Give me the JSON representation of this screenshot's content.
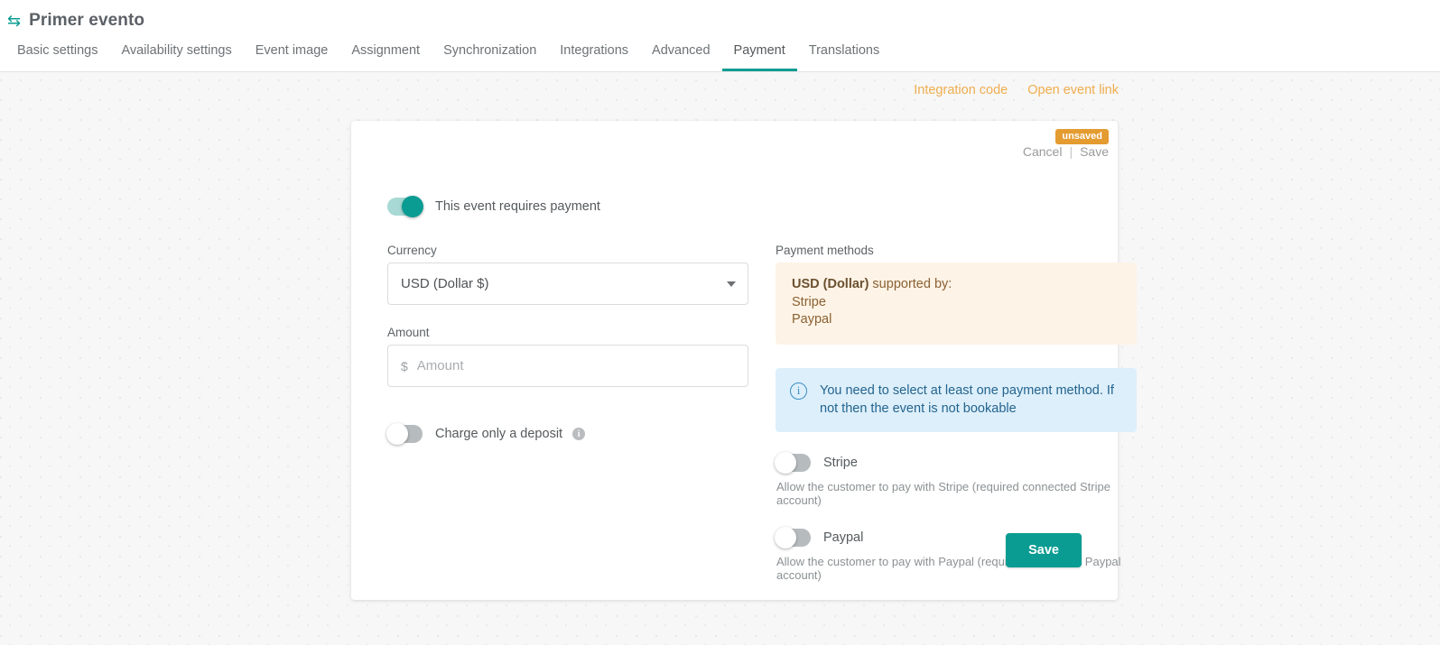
{
  "header": {
    "icon": "exchange-icon",
    "title": "Primer evento",
    "tabs": [
      {
        "label": "Basic settings",
        "active": false
      },
      {
        "label": "Availability settings",
        "active": false
      },
      {
        "label": "Event image",
        "active": false
      },
      {
        "label": "Assignment",
        "active": false
      },
      {
        "label": "Synchronization",
        "active": false
      },
      {
        "label": "Integrations",
        "active": false
      },
      {
        "label": "Advanced",
        "active": false
      },
      {
        "label": "Payment",
        "active": true
      },
      {
        "label": "Translations",
        "active": false
      }
    ]
  },
  "top_links": {
    "integration_code": "Integration code",
    "open_event_link": "Open event link",
    "color": "#f0ad4e"
  },
  "card": {
    "badge": "unsaved",
    "badge_color": "#e49b30",
    "cancel": "Cancel",
    "separator": "|",
    "save_small": "Save",
    "requires_payment": {
      "label": "This event requires payment",
      "state": "on"
    },
    "currency": {
      "label": "Currency",
      "value": "USD (Dollar $)",
      "options": [
        "USD (Dollar $)"
      ]
    },
    "amount": {
      "label": "Amount",
      "prefix": "$",
      "value": "",
      "placeholder": "Amount"
    },
    "deposit": {
      "label": "Charge only a deposit",
      "state": "off",
      "info_icon": "info-icon"
    },
    "payment_methods": {
      "label": "Payment methods",
      "supported_prefix": "USD (Dollar)",
      "supported_suffix": " supported by:",
      "supported_list": [
        "Stripe",
        "Paypal"
      ],
      "warning_bg": "#fdf3e6",
      "warning_text_color": "#8a6132",
      "info_notice": "You need to select at least one payment method. If not then the event is not bookable",
      "info_bg": "#ddeffa",
      "info_text_color": "#23648f",
      "methods": [
        {
          "name": "Stripe",
          "state": "off",
          "description": "Allow the customer to pay with Stripe (required connected Stripe account)"
        },
        {
          "name": "Paypal",
          "state": "off",
          "description": "Allow the customer to pay with Paypal (required connected Paypal account)"
        }
      ]
    },
    "save_button": "Save",
    "accent_color": "#0a9c92"
  }
}
